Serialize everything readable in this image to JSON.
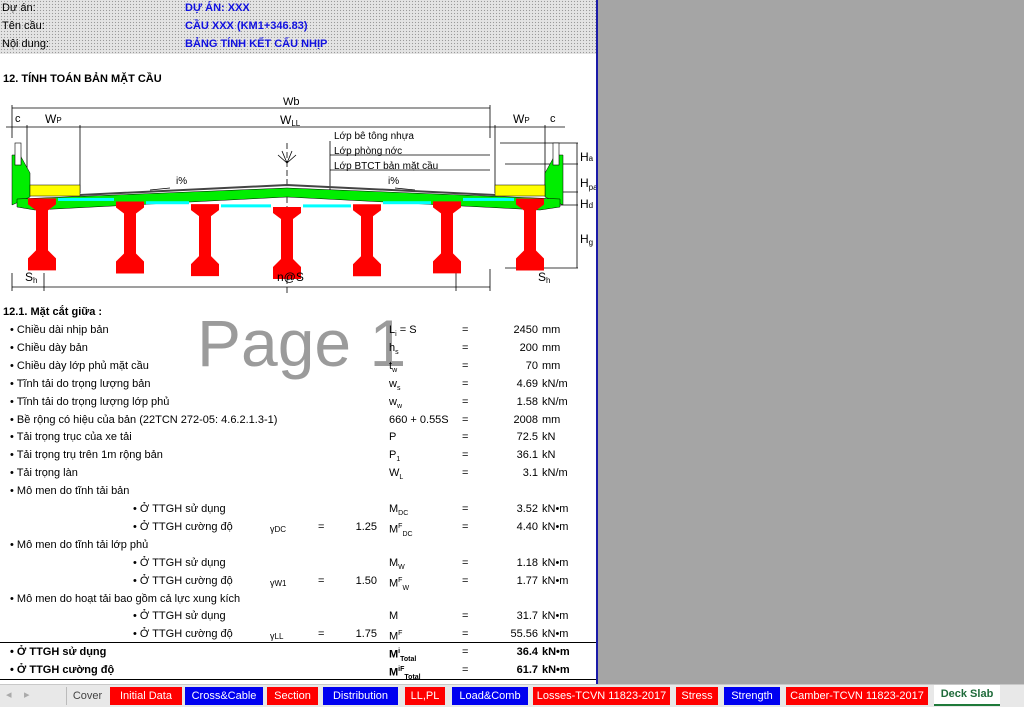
{
  "header": {
    "rows": [
      {
        "label": "Dự án:",
        "value": "DỰ ÁN: XXX"
      },
      {
        "label": "Tên cầu:",
        "value": "CẦU XXX (KM1+346.83)"
      },
      {
        "label": "Nội dung:",
        "value": "BẢNG TÍNH KẾT CẤU NHỊP"
      }
    ]
  },
  "section_title": "12. TÍNH TOÁN BẢN MẶT CẦU",
  "diagram": {
    "wb": "Wb",
    "c": "c",
    "wp": "W",
    "wp_sub": "P",
    "wll": "W",
    "wll_sub": "LL",
    "layer1": "Lớp bê tông nhựa",
    "layer2": "Lớp phòng nớc",
    "layer3": "Lớp BTCT bản mặt cầu",
    "slope": "i%",
    "ha": "H",
    "ha_sub": "a",
    "hpa": "H",
    "hpa_sub": "pa",
    "hd": "H",
    "hd_sub": "d",
    "hg": "H",
    "hg_sub": "g",
    "sh": "S",
    "sh_sub": "h",
    "nas": "n@S",
    "colors": {
      "deck": "#00ee00",
      "girder": "#ff0000",
      "sidewalk": "#ffff00",
      "haunch": "#00ffff"
    }
  },
  "watermark": "Page 1",
  "subsection": "12.1. Mặt cắt giữa :",
  "rows": [
    {
      "label": "• Chiều dài nhịp bản",
      "sym": "L",
      "symsub": "i",
      "symtail": " = S",
      "eq": "=",
      "val": "2450",
      "unit": "mm"
    },
    {
      "label": "• Chiều dày bản",
      "sym": "h",
      "symsub": "s",
      "eq": "=",
      "val": "200",
      "unit": "mm"
    },
    {
      "label": "• Chiều dày lớp phủ mặt cầu",
      "sym": "t",
      "symsub": "w",
      "eq": "=",
      "val": "70",
      "unit": "mm"
    },
    {
      "label": "• Tĩnh tải do trọng lượng bản",
      "sym": "w",
      "symsub": "s",
      "eq": "=",
      "val": "4.69",
      "unit": "kN/m"
    },
    {
      "label": "• Tĩnh tải do trọng lượng lớp phủ",
      "sym": "w",
      "symsub": "w",
      "eq": "=",
      "val": "1.58",
      "unit": "kN/m"
    },
    {
      "label": "• Bề rộng có hiệu của bản (22TCN 272-05: 4.6.2.1.3-1)",
      "sym": "660 + 0.55S",
      "eq": "=",
      "val": "2008",
      "unit": "mm"
    },
    {
      "label": "• Tải trọng trục của xe tải",
      "sym": "P",
      "eq": "=",
      "val": "72.5",
      "unit": "kN"
    },
    {
      "label": "• Tải trọng trụ trên 1m rộng bản",
      "sym": "P",
      "symsub": "1",
      "eq": "=",
      "val": "36.1",
      "unit": "kN"
    },
    {
      "label": "• Tải trọng làn",
      "sym": "W",
      "symsub": "L",
      "eq": "=",
      "val": "3.1",
      "unit": "kN/m"
    },
    {
      "label": "• Mô men do tĩnh tải bản"
    },
    {
      "sub": "• Ở TTGH sử dụng",
      "sym": "M",
      "symsub": "DC",
      "eq": "=",
      "val": "3.52",
      "unit": "kN•m"
    },
    {
      "sub": "• Ở TTGH cường độ",
      "g": "γ",
      "gsub": "DC",
      "geq": "=",
      "gval": "1.25",
      "sym": "M",
      "symsup": "F",
      "symsub": "DC",
      "eq": "=",
      "val": "4.40",
      "unit": "kN•m"
    },
    {
      "label": "• Mô men do tĩnh tải lớp phủ"
    },
    {
      "sub": "• Ở TTGH sử dụng",
      "sym": "M",
      "symsub": "W",
      "eq": "=",
      "val": "1.18",
      "unit": "kN•m"
    },
    {
      "sub": "• Ở TTGH cường độ",
      "g": "γ",
      "gsub": "W1",
      "geq": "=",
      "gval": "1.50",
      "sym": "M",
      "symsup": "F",
      "symsub": "W",
      "eq": "=",
      "val": "1.77",
      "unit": "kN•m"
    },
    {
      "label": "• Mô men do hoạt tải bao gồm cả lực xung kích"
    },
    {
      "sub": "• Ở TTGH sử dụng",
      "sym": "M",
      "eq": "=",
      "val": "31.7",
      "unit": "kN•m"
    },
    {
      "sub": "• Ở TTGH cường độ",
      "g": "γ",
      "gsub": "LL",
      "geq": "=",
      "gval": "1.75",
      "sym": "M",
      "symsup": "F",
      "eq": "=",
      "val": "55.56",
      "unit": "kN•m"
    }
  ],
  "totals": [
    {
      "label": "• Ở TTGH sử dụng",
      "sym": "M",
      "symsup": "i",
      "symsub": "Total",
      "eq": "=",
      "val": "36.4",
      "unit": "kN•m"
    },
    {
      "label": "• Ở TTGH cường độ",
      "sym": "M",
      "symsup": "iF",
      "symsub": "Total",
      "eq": "=",
      "val": "61.7",
      "unit": "kN•m"
    }
  ],
  "tabs": [
    {
      "label": "Cover",
      "color": "none"
    },
    {
      "label": "Initial Data",
      "color": "red"
    },
    {
      "label": "Cross&Cable",
      "color": "blue"
    },
    {
      "label": "Section",
      "color": "red"
    },
    {
      "label": "Distribution",
      "color": "blue"
    },
    {
      "label": "LL,PL",
      "color": "red"
    },
    {
      "label": "Load&Comb",
      "color": "blue"
    },
    {
      "label": "Losses-TCVN 11823-2017",
      "color": "red"
    },
    {
      "label": "Stress",
      "color": "red"
    },
    {
      "label": "Strength",
      "color": "blue"
    },
    {
      "label": "Camber-TCVN 11823-2017",
      "color": "red"
    },
    {
      "label": "Deck Slab",
      "color": "active"
    }
  ]
}
